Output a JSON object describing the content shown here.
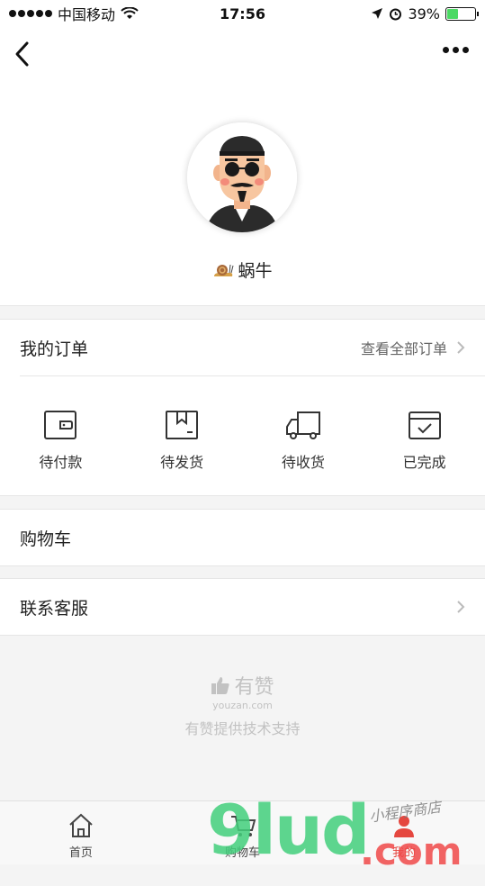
{
  "status_bar": {
    "carrier": "中国移动",
    "time": "17:56",
    "battery": "39%",
    "battery_level": 0.39
  },
  "profile": {
    "nickname": "蜗牛"
  },
  "orders": {
    "title": "我的订单",
    "view_all": "查看全部订单",
    "items": [
      {
        "label": "待付款",
        "icon": "wallet-icon"
      },
      {
        "label": "待发货",
        "icon": "box-icon"
      },
      {
        "label": "待收货",
        "icon": "truck-icon"
      },
      {
        "label": "已完成",
        "icon": "check-box-icon"
      }
    ]
  },
  "cart_row": {
    "label": "购物车"
  },
  "service_row": {
    "label": "联系客服"
  },
  "brand": {
    "name": "有赞",
    "domain": "youzan.com",
    "support": "有赞提供技术支持"
  },
  "tabbar": {
    "tabs": [
      {
        "label": "首页",
        "icon": "home-icon"
      },
      {
        "label": "购物车",
        "icon": "cart-icon"
      },
      {
        "label": "我的",
        "icon": "user-icon",
        "active": true
      }
    ]
  },
  "watermark": {
    "brand": "9lud",
    "suffix": ".com",
    "caption": "小程序商店"
  },
  "colors": {
    "accent": "#e5473f",
    "battery": "#4cd964",
    "watermark_green": "#43cf7c"
  }
}
